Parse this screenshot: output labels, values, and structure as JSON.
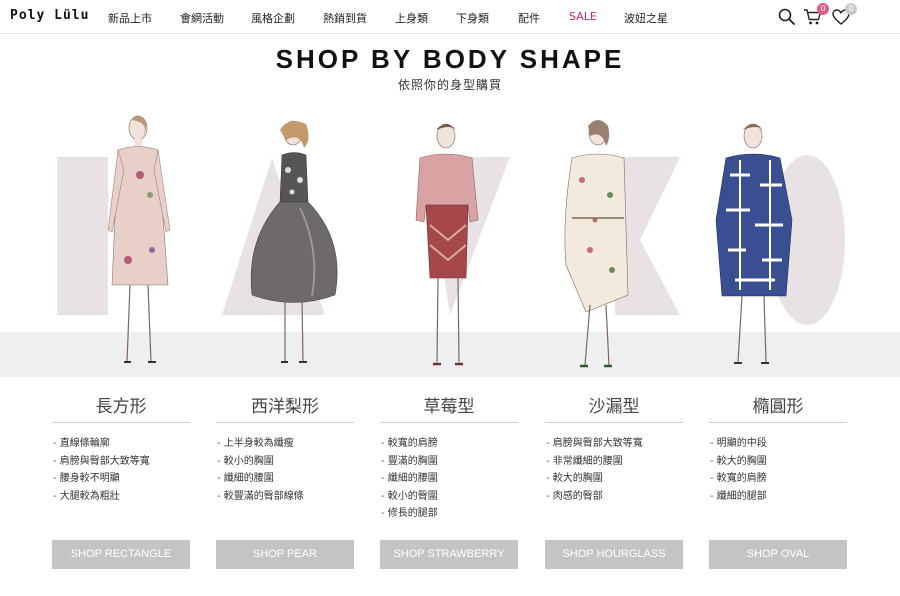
{
  "brand": {
    "logo": "Poly Lülu"
  },
  "nav": {
    "items": [
      "新品上市",
      "會網活動",
      "風格企劃",
      "熱銷到貨",
      "上身類",
      "下身類",
      "配件",
      "SALE",
      "波妞之星"
    ]
  },
  "header_icons": {
    "search": "search-icon",
    "cart": "cart-icon",
    "wishlist": "heart-icon",
    "cart_count": "0",
    "wishlist_count": "0"
  },
  "hero": {
    "title": "SHOP BY BODY SHAPE",
    "subtitle": "依照你的身型購買"
  },
  "shapes": [
    {
      "name": "長方形",
      "features": [
        "直線條輪廓",
        "肩膀與臀部大致等寬",
        "腰身較不明顯",
        "大腿較為粗壯"
      ],
      "button": "SHOP RECTANGLE"
    },
    {
      "name": "西洋梨形",
      "features": [
        "上半身較為纖瘦",
        "較小的胸圍",
        "纖細的腰圍",
        "較豐滿的臀部線條"
      ],
      "button": "SHOP PEAR"
    },
    {
      "name": "草莓型",
      "features": [
        "較寬的肩膀",
        "豐滿的胸圍",
        "纖細的腰圍",
        "較小的臀圍",
        "修長的腿部"
      ],
      "button": "SHOP STRAWBERRY"
    },
    {
      "name": "沙漏型",
      "features": [
        "肩膀與臀部大致等寬",
        "非常纖細的腰圍",
        "較大的胸圍",
        "肉感的臀部"
      ],
      "button": "SHOP HOURGLASS"
    },
    {
      "name": "橢圓形",
      "features": [
        "明顯的中段",
        "較大的胸圍",
        "較寬的肩膀",
        "纖細的腿部"
      ],
      "button": "SHOP OVAL"
    }
  ],
  "colors": {
    "sale": "#d6246e",
    "badge": "#e85a86",
    "button_bg": "#c4c4c4",
    "letter_shape": "#e2d8db"
  }
}
